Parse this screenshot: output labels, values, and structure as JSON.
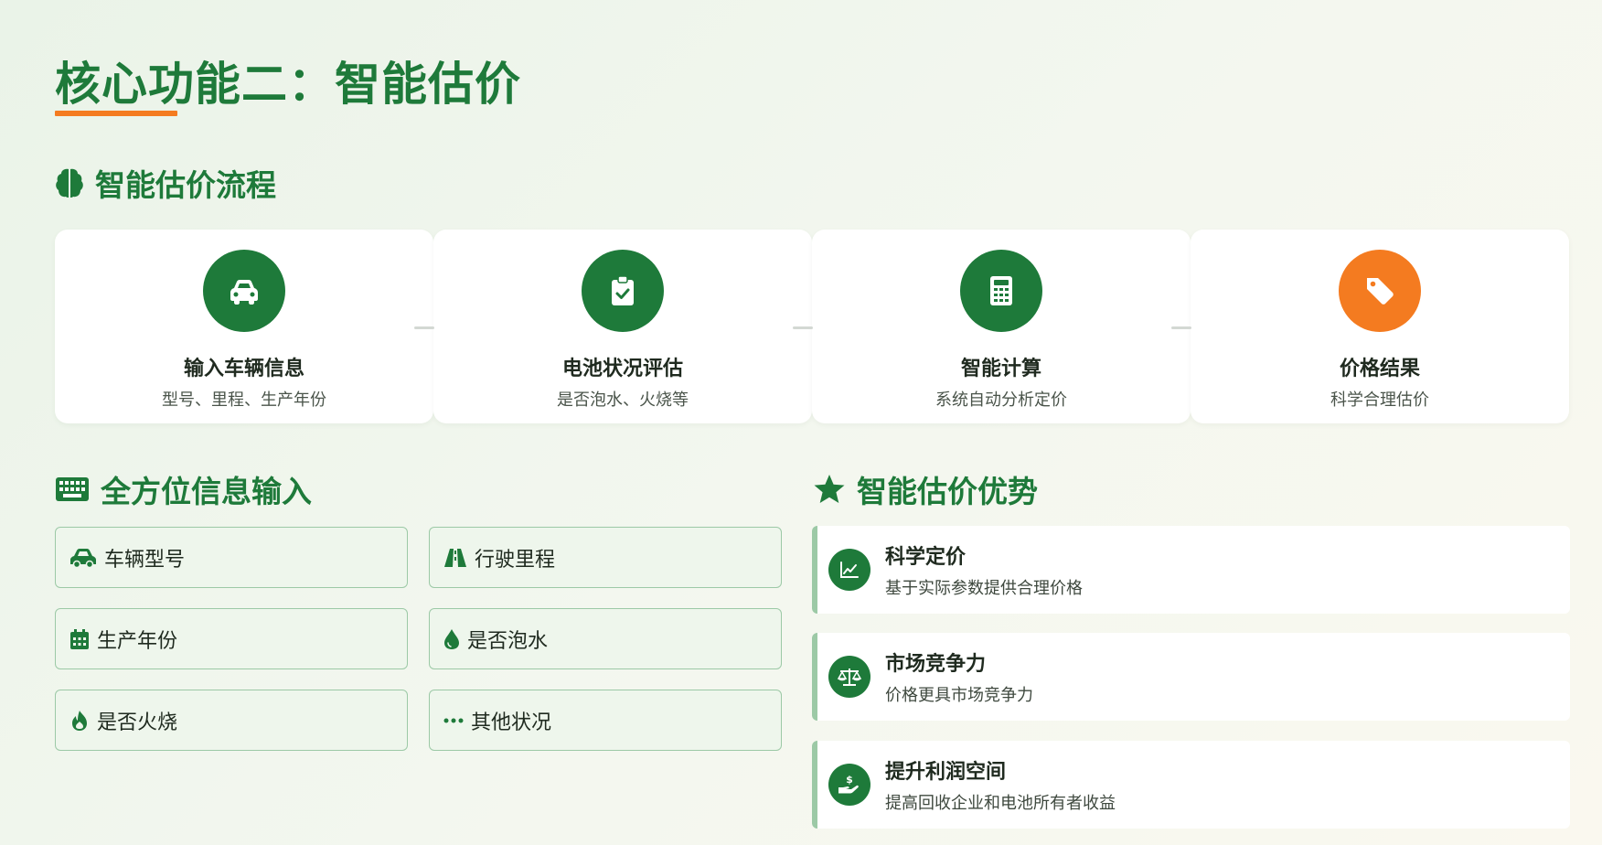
{
  "title": "核心功能二：智能估价",
  "colors": {
    "primary": "#1e7a3a",
    "accent": "#f47b20",
    "card_border": "#9cc9a6"
  },
  "flow": {
    "heading": "智能估价流程",
    "heading_icon": "brain-icon",
    "steps": [
      {
        "icon": "car-icon",
        "title": "输入车辆信息",
        "subtitle": "型号、里程、生产年份"
      },
      {
        "icon": "clipboard-check-icon",
        "title": "电池状况评估",
        "subtitle": "是否泡水、火烧等"
      },
      {
        "icon": "calculator-icon",
        "title": "智能计算",
        "subtitle": "系统自动分析定价"
      },
      {
        "icon": "price-tag-icon",
        "title": "价格结果",
        "subtitle": "科学合理估价"
      }
    ]
  },
  "inputs": {
    "heading": "全方位信息输入",
    "heading_icon": "keyboard-icon",
    "items": [
      {
        "icon": "car-icon",
        "label": "车辆型号"
      },
      {
        "icon": "road-icon",
        "label": "行驶里程"
      },
      {
        "icon": "calendar-icon",
        "label": "生产年份"
      },
      {
        "icon": "water-drop-icon",
        "label": "是否泡水"
      },
      {
        "icon": "fire-icon",
        "label": "是否火烧"
      },
      {
        "icon": "ellipsis-icon",
        "label": "其他状况"
      }
    ]
  },
  "advantages": {
    "heading": "智能估价优势",
    "heading_icon": "star-icon",
    "items": [
      {
        "icon": "chart-line-icon",
        "title": "科学定价",
        "description": "基于实际参数提供合理价格"
      },
      {
        "icon": "balance-scale-icon",
        "title": "市场竞争力",
        "description": "价格更具市场竞争力"
      },
      {
        "icon": "hand-dollar-icon",
        "title": "提升利润空间",
        "description": "提高回收企业和电池所有者收益"
      }
    ]
  }
}
